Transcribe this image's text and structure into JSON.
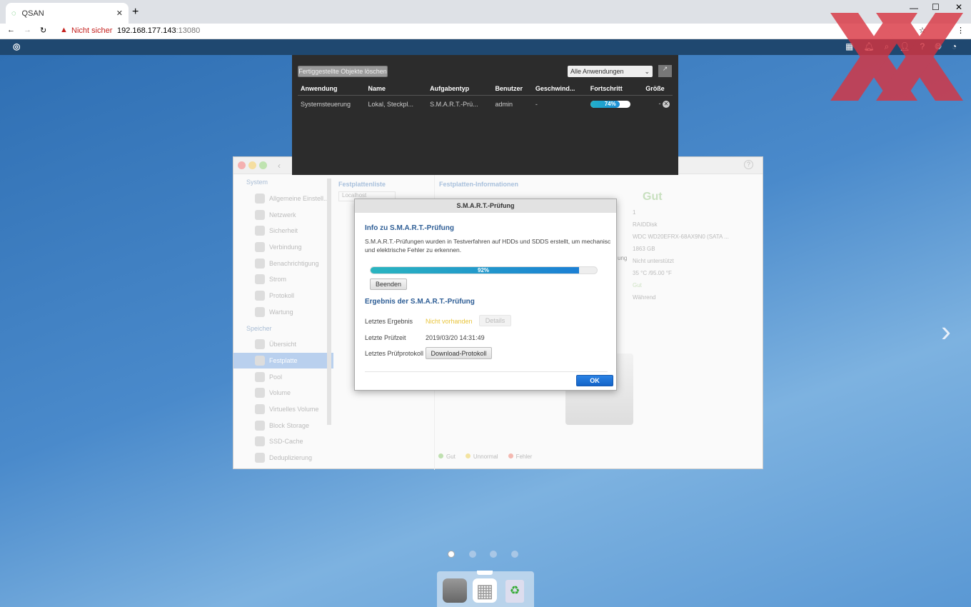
{
  "browser": {
    "tab_title": "QSAN",
    "security": "Nicht sicher",
    "url_host": "192.168.177.143",
    "url_port": ":13080"
  },
  "task_panel": {
    "clear_button": "Fertiggestellte Objekte löschen",
    "filter": "Alle Anwendungen",
    "columns": [
      "Anwendung",
      "Name",
      "Aufgabentyp",
      "Benutzer",
      "Geschwind...",
      "Fortschritt",
      "Größe"
    ],
    "rows": [
      {
        "app": "Systemsteuerung",
        "name": "Lokal, Steckpl...",
        "type": "S.M.A.R.T.-Prü...",
        "user": "admin",
        "speed": "-",
        "progress_label": "74%",
        "progress": 74,
        "size": "-"
      }
    ]
  },
  "control_panel": {
    "sidebar": [
      {
        "label": "System",
        "header": true
      },
      {
        "label": "Allgemeine Einstell..."
      },
      {
        "label": "Netzwerk"
      },
      {
        "label": "Sicherheit"
      },
      {
        "label": "Verbindung"
      },
      {
        "label": "Benachrichtigung"
      },
      {
        "label": "Strom"
      },
      {
        "label": "Protokoll"
      },
      {
        "label": "Wartung"
      },
      {
        "label": "Speicher",
        "header": true
      },
      {
        "label": "Übersicht"
      },
      {
        "label": "Festplatte",
        "selected": true
      },
      {
        "label": "Pool"
      },
      {
        "label": "Volume"
      },
      {
        "label": "Virtuelles Volume"
      },
      {
        "label": "Block Storage"
      },
      {
        "label": "SSD-Cache"
      },
      {
        "label": "Deduplizierung"
      }
    ],
    "disk_list_title": "Festplattenliste",
    "disk_list_select": "Localhost",
    "info_title": "Festplatten-Informationen",
    "status": "Gut",
    "info_label_fragment": "ung",
    "info_values": [
      "1",
      "RAIDDisk",
      "WDC WD20EFRX-68AX9N0 (SATA ...",
      "1863 GB",
      "Nicht unterstützt",
      "35 °C /95.00 °F",
      "Gut",
      "Während"
    ],
    "legend": [
      "Gut",
      "Unnormal",
      "Fehler"
    ]
  },
  "dialog": {
    "title": "S.M.A.R.T.-Prüfung",
    "info_heading": "Info zu S.M.A.R.T.-Prüfung",
    "info_text": "S.M.A.R.T.-Prüfungen wurden in Testverfahren auf HDDs und SDDS erstellt, um mechanisc und elektrische Fehler zu erkennen.",
    "progress_label": "92%",
    "progress": 92,
    "stop_button": "Beenden",
    "result_heading": "Ergebnis der S.M.A.R.T.-Prüfung",
    "last_result_label": "Letztes Ergebnis",
    "last_result_value": "Nicht vorhanden",
    "details_button": "Details",
    "last_time_label": "Letzte Prüfzeit",
    "last_time_value": "2019/03/20 14:31:49",
    "last_log_label": "Letztes Prüfprotokoll",
    "download_button": "Download-Protokoll",
    "ok_button": "OK"
  },
  "colors": {
    "accent": "#1a6fd6",
    "qsan_bar": "#1f4870",
    "progress": "#1ea0d8",
    "warning": "#e8c43a",
    "watermark": "#d9333f"
  },
  "pager": {
    "pages": 4,
    "current": 1
  }
}
